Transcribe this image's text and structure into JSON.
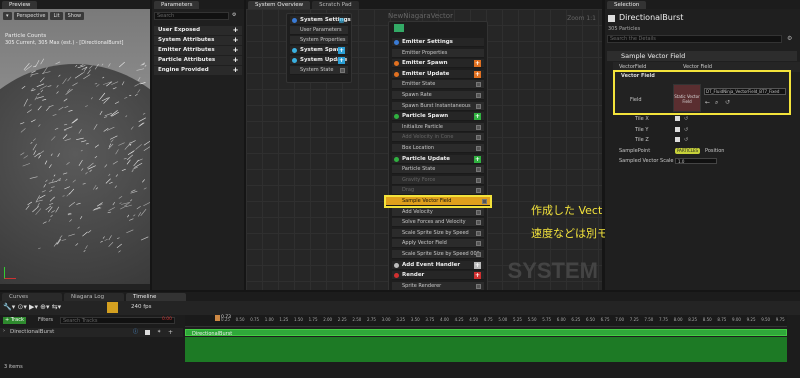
{
  "preview": {
    "tab": "Preview",
    "perspective": "Perspective",
    "lit": "Lit",
    "show": "Show",
    "counts_title": "Particle Counts",
    "counts_line": "305 Current, 305 Max (est.) - [DirectionalBurst]"
  },
  "parameters": {
    "tab": "Parameters",
    "search_placeholder": "Search",
    "sections": [
      "User Exposed",
      "System Attributes",
      "Emitter Attributes",
      "Particle Attributes",
      "Engine Provided"
    ]
  },
  "graph": {
    "tab_overview": "System Overview",
    "tab_scratch": "Scratch Pad",
    "title": "NewNiagaraVector",
    "zoom": "Zoom 1:1",
    "watermark": "SYSTEM",
    "system_node": [
      "System Settings",
      "User Parameters",
      "System Properties",
      "System Spawn",
      "System Update",
      "System State"
    ],
    "emitter_rows": [
      {
        "t": "Emitter Settings",
        "k": "head",
        "c": "#3a7bd5"
      },
      {
        "t": "Emitter Properties",
        "k": ""
      },
      {
        "t": "Emitter Spawn",
        "k": "head",
        "c": "#e07020",
        "b": "+"
      },
      {
        "t": "Emitter Update",
        "k": "head",
        "c": "#e07020",
        "b": "+"
      },
      {
        "t": "Emitter State",
        "k": "chk"
      },
      {
        "t": "Spawn Rate",
        "k": "chk"
      },
      {
        "t": "Spawn Burst Instantaneous",
        "k": "chk"
      },
      {
        "t": "Particle Spawn",
        "k": "head",
        "c": "#30b040",
        "b": "+"
      },
      {
        "t": "Initialize Particle",
        "k": "chk"
      },
      {
        "t": "Add Velocity in Cone",
        "k": "dim"
      },
      {
        "t": "Box Location",
        "k": "chk"
      },
      {
        "t": "Particle Update",
        "k": "head",
        "c": "#30b040",
        "b": "+"
      },
      {
        "t": "Particle State",
        "k": "chk"
      },
      {
        "t": "Gravity Force",
        "k": "dim"
      },
      {
        "t": "Drag",
        "k": "dim"
      },
      {
        "t": "Sample Vector Field",
        "k": "sel"
      },
      {
        "t": "Add Velocity",
        "k": "chk"
      },
      {
        "t": "Solve Forces and Velocity",
        "k": "chk"
      },
      {
        "t": "Scale Sprite Size by Speed",
        "k": "chk"
      },
      {
        "t": "Apply Vector Field",
        "k": "chk"
      },
      {
        "t": "Scale Sprite Size by Speed 001",
        "k": "chk"
      },
      {
        "t": "Add Event Handler",
        "k": "head",
        "c": "#bbb",
        "b": "+"
      },
      {
        "t": "Render",
        "k": "head",
        "c": "#d03030",
        "b": "+"
      },
      {
        "t": "Sprite Renderer",
        "k": "chk"
      }
    ]
  },
  "annotation": {
    "line1": "作成した Vector Field を読み込んだ。",
    "line2": "速度などは別モジュールで設定すること"
  },
  "selection": {
    "tab": "Selection",
    "title": "DirectionalBurst",
    "count": "305 Particles",
    "search_placeholder": "Search the Details",
    "module": "Sample Vector Field",
    "vf_label": "VectorField",
    "vf_value": "Vector Field",
    "vf_header": "Vector Field",
    "field_label": "Field",
    "field_thumb": "Static Vector Field",
    "field_asset": "DT_FluidNinja_VectorField_BT7_Fixed",
    "props": [
      {
        "n": "Tile X"
      },
      {
        "n": "Tile Y"
      },
      {
        "n": "Tile Z"
      }
    ],
    "sample_point": "SamplePoint",
    "sample_badge": "PARTICLES",
    "sample_value": "Position",
    "scale_label": "Sampled Vector Scale",
    "scale_value": "1.0"
  },
  "bottom": {
    "tabs": [
      "Curves",
      "Niagara Log",
      "Timeline"
    ],
    "track_btn": "+ Track",
    "filters": "Filters",
    "search_placeholder": "Search Tracks",
    "fps": "240 fps",
    "time_start": "0.00",
    "playhead": "0.73",
    "ticks": [
      "0.25",
      "0.50",
      "0.75",
      "1.00",
      "1.25",
      "1.50",
      "1.75",
      "2.00",
      "2.25",
      "2.50",
      "2.75",
      "3.00",
      "3.25",
      "3.50",
      "3.75",
      "4.00",
      "4.25",
      "4.50",
      "4.75",
      "5.00",
      "5.25",
      "5.50",
      "5.75",
      "6.00",
      "6.25",
      "6.50",
      "6.75",
      "7.00",
      "7.25",
      "7.50",
      "7.75",
      "8.00",
      "8.25",
      "8.50",
      "8.75",
      "9.00",
      "9.25",
      "9.50",
      "9.75"
    ],
    "track": "DirectionalBurst",
    "clip": "DirectionalBurst",
    "items": "3 items"
  }
}
